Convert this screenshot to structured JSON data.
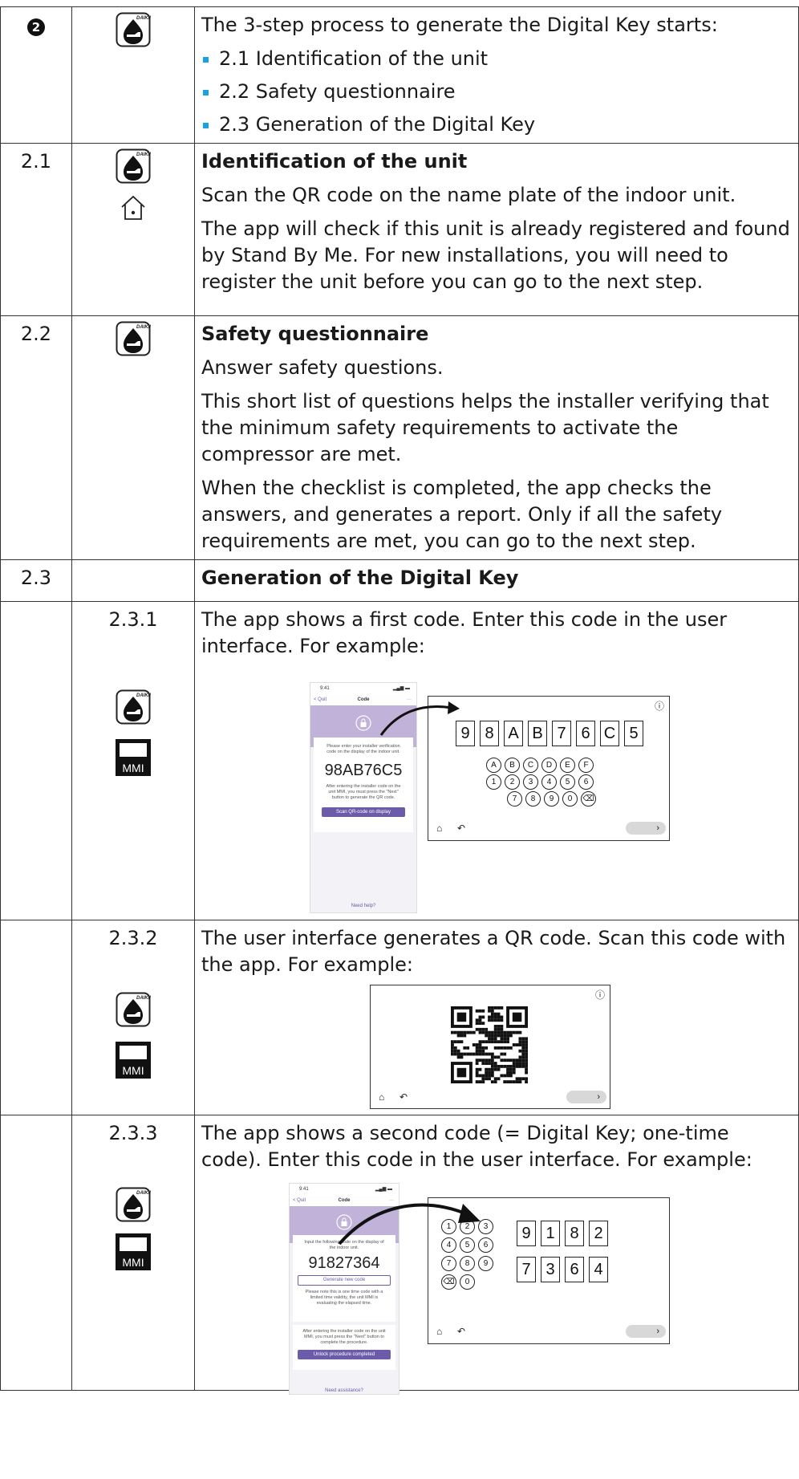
{
  "row_step2": {
    "marker": "2",
    "text": "The 3-step process to generate the Digital Key starts:",
    "bullets": [
      "2.1 Identification of the unit",
      "2.2 Safety questionnaire",
      "2.3 Generation of the Digital Key"
    ]
  },
  "row_21": {
    "num": "2.1",
    "title": "Identification of the unit",
    "p1": "Scan the QR code on the name plate of the indoor unit.",
    "p2": "The app will check if this unit is already registered and found by Stand By Me. For new installations, you will need to register the unit before you can go to the next step."
  },
  "row_22": {
    "num": "2.2",
    "title": "Safety questionnaire",
    "p1": "Answer safety questions.",
    "p2": "This short list of questions helps the installer verifying that the minimum safety requirements to activate the compressor are met.",
    "p3": "When the checklist is completed, the app checks the answers, and generates a report. Only if all the safety requirements are met, you can go to the next step."
  },
  "row_23": {
    "num": "2.3",
    "title": "Generation of the Digital Key"
  },
  "row_231": {
    "num": "2.3.1",
    "text": "The app shows a first code. Enter this code in the user interface. For example:",
    "phone": {
      "time": "9:41",
      "back": "< Quit",
      "title": "Code",
      "more": "···",
      "instr": "Please enter your installer verification code on the display of the indoor unit.",
      "code": "98AB76C5",
      "note": "After entering the installer code on the unit MMI, you must press the \"Next\" button to generate the QR code.",
      "button": "Scan QR-code on display",
      "help": "Need help?"
    },
    "ui": {
      "keys": [
        "9",
        "8",
        "A",
        "B",
        "7",
        "6",
        "C",
        "5"
      ],
      "row1": [
        "A",
        "B",
        "C",
        "D",
        "E",
        "F"
      ],
      "row2": [
        "1",
        "2",
        "3",
        "4",
        "5",
        "6"
      ],
      "row3": [
        "7",
        "8",
        "9",
        "0",
        "⌫"
      ]
    }
  },
  "row_232": {
    "num": "2.3.2",
    "text": "The user interface generates a QR code. Scan this code with the app. For example:"
  },
  "row_233": {
    "num": "2.3.3",
    "text": "The app shows a second code (= Digital Key; one-time code). Enter this code in the user interface. For example:",
    "phone": {
      "time": "9:41",
      "back": "< Quit",
      "title": "Code",
      "more": "···",
      "instr": "Input the following code on the display of the indoor unit.",
      "code": "91827364",
      "gen": "Generate new code",
      "note": "Please note this is one time code with a limited time validity, the unit MMI is evaluating the elapsed time.",
      "note2": "After entering the installer code on the unit MMI, you must press the \"Next\" button to complete the procedure.",
      "button": "Unlock procedure completed",
      "help": "Need assistance?"
    },
    "ui": {
      "pad": [
        "1",
        "2",
        "3",
        "4",
        "5",
        "6",
        "7",
        "8",
        "9",
        "⌫",
        "0"
      ],
      "keys_row1": [
        "9",
        "1",
        "8",
        "2"
      ],
      "keys_row2": [
        "7",
        "3",
        "6",
        "4"
      ]
    }
  },
  "common": {
    "mmi_label": "MMI",
    "app_label": "DAIKIN",
    "next": "›"
  }
}
